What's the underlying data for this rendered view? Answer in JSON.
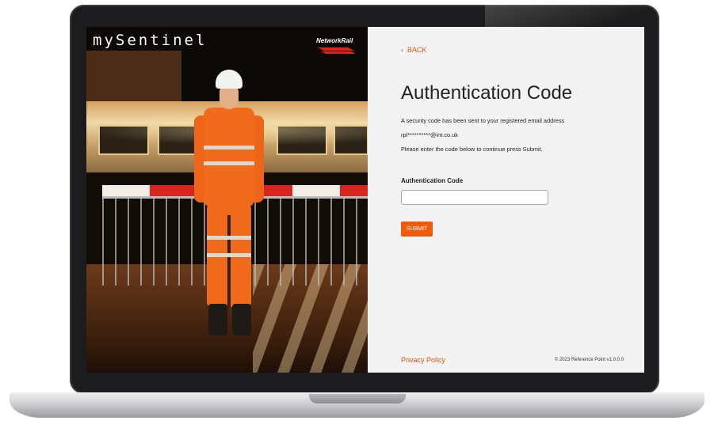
{
  "brand": {
    "app_name": "mySentinel",
    "partner_logo": "NetworkRail"
  },
  "form": {
    "back_icon": "‹",
    "back_label": "BACK",
    "title": "Authentication Code",
    "line1": "A security code has been sent to your registered email address",
    "masked_email": "rpl**********@int.co.uk",
    "line3": "Please enter the code below to continue press Submit.",
    "field_label": "Authentication Code",
    "field_value": "",
    "submit_label": "SUBMIT"
  },
  "footer": {
    "privacy_label": "Privacy Policy",
    "copyright": "© 2023 Reference Point v1.0.0.0"
  },
  "colors": {
    "accent": "#f05a0c",
    "panel_bg": "#f3f3f3",
    "frame": "#1c1c1e"
  }
}
